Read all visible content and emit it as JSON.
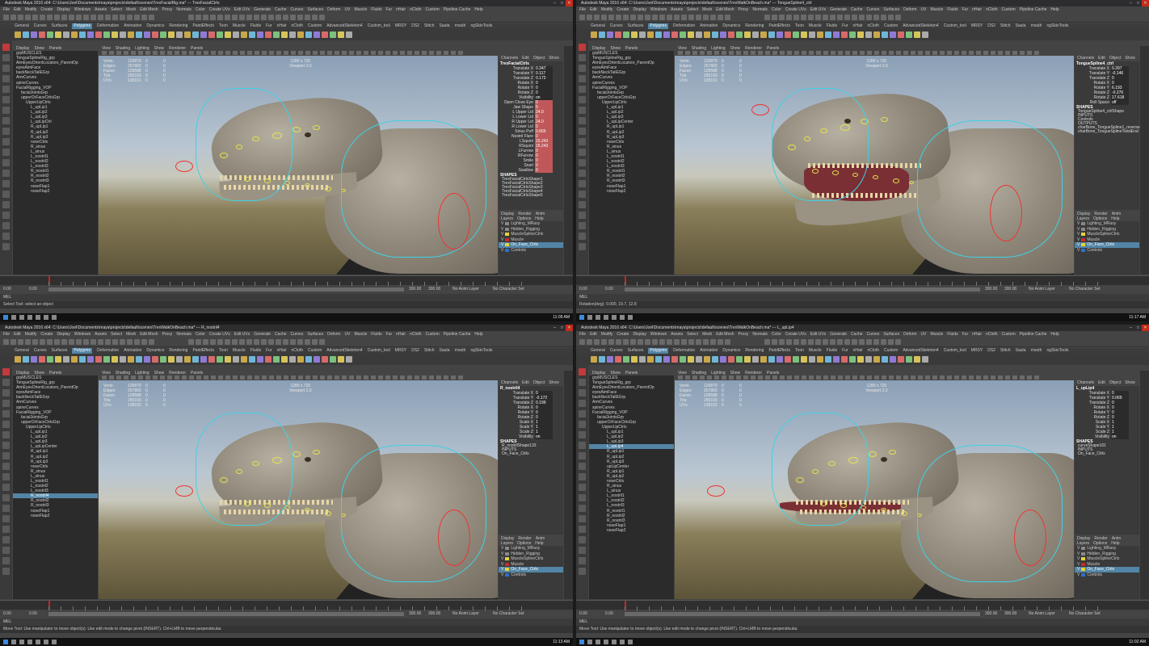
{
  "menus": [
    "File",
    "Edit",
    "Modify",
    "Create",
    "Display",
    "Windows",
    "Assets",
    "Select",
    "Mesh",
    "Edit Mesh",
    "Proxy",
    "Normals",
    "Color",
    "Create UVs",
    "Edit UVs",
    "Generate",
    "Cache",
    "Curves",
    "Surfaces",
    "Deform",
    "UV",
    "Muscle",
    "Fluids",
    "Fur",
    "nHair",
    "nCloth",
    "Custom",
    "Pipeline Cache",
    "Help"
  ],
  "shelf_tabs": [
    "General",
    "Curves",
    "Surfaces",
    "Polygons",
    "Deformation",
    "Animation",
    "Dynamics",
    "Rendering",
    "PaintEffects",
    "Toon",
    "Muscle",
    "Fluids",
    "Fur",
    "nHair",
    "nCloth",
    "Custom",
    "AdvancedSkeleton4",
    "Custom_tool",
    "MRSY",
    "DS2",
    "Stitch",
    "Sauta",
    "mouth",
    "ngSkinTools"
  ],
  "outliner_menu": [
    "Display",
    "Show",
    "Panels"
  ],
  "viewport_menu": [
    "View",
    "Shading",
    "Lighting",
    "Show",
    "Renderer",
    "Panels"
  ],
  "hud": {
    "labels": [
      "Verts:",
      "Edges:",
      "Faces:",
      "Tris:",
      "UVs:"
    ],
    "values": [
      "129879",
      "257800",
      "128588",
      "255193",
      "138191"
    ],
    "col2": [
      "0",
      "0",
      "0",
      "0",
      "0"
    ],
    "col3": [
      "0",
      "0",
      "0",
      "0",
      "0"
    ],
    "res": "1280 x 720",
    "viewport": "Viewport 2.0"
  },
  "channel_tabs": [
    "Channels",
    "Edit",
    "Object",
    "Show"
  ],
  "layer_tabs": [
    "Display",
    "Render",
    "Anim"
  ],
  "layer_menu": [
    "Layers",
    "Options",
    "Help"
  ],
  "layers": [
    "Lighting_MRasy",
    "Hidden_Rigging",
    "MuscleSplineCtrls",
    "Muscle",
    "On_Face_Ctrls",
    "Controls"
  ],
  "layer_colors": [
    "#888888",
    "#888888",
    "#e6d23a",
    "#c22d2d",
    "#e6d23a",
    "#3070c8"
  ],
  "timeline": {
    "start": "0.00",
    "end": "0.00",
    "range_a": "300.00",
    "range_b": "300.00",
    "anim_layer": "No Anim Layer",
    "char_set": "No Character Set"
  },
  "cmd_label": "MEL",
  "quads": [
    {
      "title": "Autodesk Maya 2016 x64: C:\\Users\\Joel\\Documents\\maya\\projects\\default\\scenes\\TrexFacialRig.ma* --- TrexFacialCtrls",
      "outliner": [
        "grpMUSCLES",
        "TongueSplineRig_grp",
        "AimEyesOrientLocators_ParentOp",
        "eyesAimFace",
        "backNeckTailEGrp",
        "ArmCurves",
        "spineCurves",
        "FacialRigging_VOP",
        "facialJointsGrp",
        "upperOrFaceCtrlsGrp",
        "UpperLipCtrls",
        "L_upLip1",
        "L_upLip2",
        "L_upLip3",
        "L_upLipCtrl",
        "R_upLip1",
        "R_upLip2",
        "R_upLip3",
        "noseCtrls",
        "R_sinus",
        "L_sinus",
        "L_nostril1",
        "L_nostril2",
        "L_nostril3",
        "R_nostril1",
        "R_nostril2",
        "R_nostril3",
        "noseFlap1",
        "noseFlap2"
      ],
      "outliner_sel": -1,
      "cb_title": "TrexFacialCtrls",
      "cb_rows": [
        [
          "Translate X",
          "0.347"
        ],
        [
          "Translate Y",
          "0.117"
        ],
        [
          "Translate Z",
          "0.172"
        ],
        [
          "Rotate X",
          "0"
        ],
        [
          "Rotate Y",
          "0"
        ],
        [
          "Rotate Z",
          "0"
        ],
        [
          "Visibility",
          "on"
        ],
        [
          "Open Close Eye",
          "0"
        ],
        [
          "Jaw Shape",
          "5"
        ],
        [
          "L Upper Lid",
          "24.0"
        ],
        [
          "L Lower Lid",
          "0"
        ],
        [
          "R Upper Lid",
          "24.0"
        ],
        [
          "R Lower Lid",
          "0"
        ],
        [
          "Sinus Puff",
          "0.665"
        ],
        [
          "Nostril Flare",
          "0"
        ],
        [
          "LSquint",
          "15.243"
        ],
        [
          "RSquint",
          "15.243"
        ],
        [
          "LFurrow",
          "0"
        ],
        [
          "RFurrow",
          "0"
        ],
        [
          "Smile",
          "0"
        ],
        [
          "Snarl",
          "0"
        ],
        [
          "Swallow",
          "0"
        ]
      ],
      "cb_red_from": 7,
      "cb_shapes_label": "SHAPES",
      "cb_shapes": [
        "TrexFacialCtrlsShape1",
        "TrexFacialCtrlsShape2",
        "TrexFacialCtrlsShape3",
        "TrexFacialCtrlsShape4",
        "TrexFacialCtrlsShape5"
      ],
      "layer_sel": 4,
      "help": "Select Tool: select an object",
      "clock": "11:09 AM"
    },
    {
      "title": "Autodesk Maya 2016 x64: C:\\Users\\Joel\\Documents\\maya\\projects\\default\\scenes\\TrexWalkOnBeach.ma* --- TongueSpline4_ctrl",
      "outliner": [
        "grpMUSCLES",
        "TongueSplineRig_grp",
        "AimEyesOrientLocators_ParentOp",
        "eyesAimFace",
        "backNeckTailEGrp",
        "ArmCurves",
        "spineCurves",
        "FacialRigging_VOP",
        "facialJointsGrp",
        "upperOrFaceCtrlsGrp",
        "UpperLipCtrls",
        "L_upLip1",
        "L_upLip2",
        "L_upLip3",
        "L_upLipCenter",
        "R_upLip1",
        "R_upLip2",
        "R_upLip3",
        "noseCtrls",
        "R_sinus",
        "L_sinus",
        "L_nostril1",
        "L_nostril2",
        "L_nostril3",
        "R_nostril1",
        "R_nostril2",
        "R_nostril3",
        "noseFlap1",
        "noseFlap2"
      ],
      "outliner_sel": -1,
      "cb_title": "TongueSpline4_ctrl",
      "cb_rows": [
        [
          "Translate X",
          "0.397"
        ],
        [
          "Translate Y",
          "-0.146"
        ],
        [
          "Translate Z",
          "0"
        ],
        [
          "Rotate X",
          "0"
        ],
        [
          "Rotate Y",
          "6.193"
        ],
        [
          "Rotate Z",
          "-0.276"
        ],
        [
          "Rotate Z",
          "17.618"
        ],
        [
          "Roll Space",
          "off"
        ]
      ],
      "cb_red_from": 99,
      "cb_shapes_label": "SHAPES",
      "cb_shapes": [
        "TongueSpline4_ctrlShape",
        "INPUTS",
        "Controls",
        "OUTPUTS",
        "charBone_TongueSpline1_reverse",
        "charBone_TongueSplineTwistEnd"
      ],
      "layer_sel": 4,
      "help": "Rotation(deg): 0.000, 19.7, 12.8",
      "clock": "11:17 AM"
    },
    {
      "title": "Autodesk Maya 2016 x64: C:\\Users\\Joel\\Documents\\maya\\projects\\default\\scenes\\TrexWalkOnBeach.ma* --- R_nostril4",
      "outliner": [
        "grpMUSCLES",
        "TongueSplineRig_grp",
        "AimEyesOrientLocators_ParentOp",
        "eyesAimFace",
        "backNeckTailEGrp",
        "ArmCurves",
        "spineCurves",
        "FacialRigging_VOP",
        "facialJointsGrp",
        "upperOrFaceCtrlsGrp",
        "UpperLipCtrls",
        "L_upLip1",
        "L_upLip2",
        "L_upLip3",
        "L_upLipCenter",
        "R_upLip1",
        "R_upLip2",
        "R_upLip3",
        "noseCtrls",
        "R_sinus",
        "L_sinus",
        "L_nostril1",
        "L_nostril2",
        "L_nostril3",
        "R_nostril4",
        "R_nostril2",
        "R_nostril3",
        "noseFlap1",
        "noseFlap2"
      ],
      "outliner_sel": 24,
      "cb_title": "R_nostril4",
      "cb_rows": [
        [
          "Translate X",
          "0"
        ],
        [
          "Translate Y",
          "-0.172"
        ],
        [
          "Translate Z",
          "0.199"
        ],
        [
          "Rotate X",
          "0"
        ],
        [
          "Rotate Y",
          "0"
        ],
        [
          "Rotate Z",
          "0"
        ],
        [
          "Scale X",
          "1"
        ],
        [
          "Scale Y",
          "1"
        ],
        [
          "Scale Z",
          "1"
        ],
        [
          "Visibility",
          "on"
        ]
      ],
      "cb_red_from": 99,
      "cb_shapes_label": "SHAPES",
      "cb_shapes": [
        "R_nostrilShape133",
        "INPUTS",
        "On_Face_Ctrls"
      ],
      "layer_sel": 4,
      "help": "Move Tool: Use manipulator to move object(s). Use edit mode to change pivot (INSERT). Ctrl+LMB to move perpendicular.",
      "clock": "11:13 AM"
    },
    {
      "title": "Autodesk Maya 2016 x64: C:\\Users\\Joel\\Documents\\maya\\projects\\default\\scenes\\TrexWalkOnBeach.ma* --- L_upLip4",
      "outliner": [
        "grpMUSCLES",
        "TongueSplineRig_grp",
        "AimEyesOrientLocators_ParentOp",
        "eyesAimFace",
        "backNeckTailEGrp",
        "ArmCurves",
        "spineCurves",
        "FacialRigging_VOP",
        "facialJointsGrp",
        "upperOrFaceCtrlsGrp",
        "UpperLipCtrls",
        "L_upLip1",
        "L_upLip2",
        "L_upLip3",
        "L_upLip4",
        "R_upLip1",
        "R_upLip2",
        "R_upLip3",
        "upLipCenter",
        "R_upLip1",
        "R_upLip2",
        "noseCtrls",
        "R_sinus",
        "L_sinus",
        "L_nostril1",
        "L_nostril2",
        "L_nostril3",
        "R_nostril1",
        "R_nostril2",
        "R_nostril3",
        "noseFlap1",
        "noseFlap2"
      ],
      "outliner_sel": 14,
      "cb_title": "L_upLip4",
      "cb_rows": [
        [
          "Translate X",
          "0"
        ],
        [
          "Translate Y",
          "0.069"
        ],
        [
          "Translate Z",
          "0"
        ],
        [
          "Rotate X",
          "0"
        ],
        [
          "Rotate Y",
          "0"
        ],
        [
          "Rotate Z",
          "0"
        ],
        [
          "Scale X",
          "1"
        ],
        [
          "Scale Y",
          "1"
        ],
        [
          "Scale Z",
          "1"
        ],
        [
          "Visibility",
          "on"
        ]
      ],
      "cb_red_from": 99,
      "cb_shapes_label": "SHAPES",
      "cb_shapes": [
        "curveShape101",
        "INPUTS",
        "On_Face_Ctrls"
      ],
      "layer_sel": 4,
      "help": "Move Tool: Use manipulator to move object(s). Use edit mode to change pivot (INSERT). Ctrl+LMB to move perpendicular.",
      "clock": "11:02 AM"
    }
  ]
}
